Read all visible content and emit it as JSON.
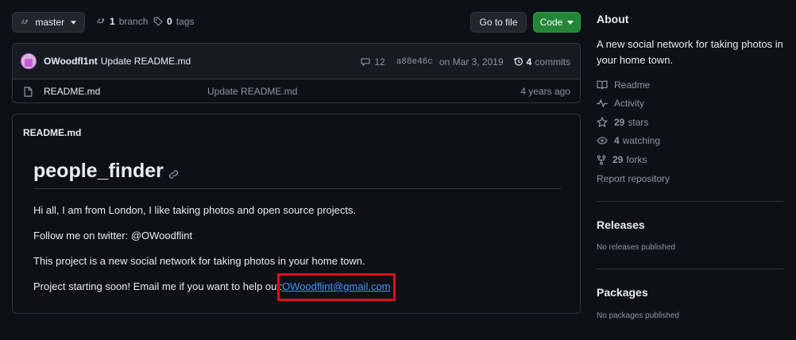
{
  "repo_nav": {
    "branch_name": "master",
    "branch_count": "1",
    "branch_label": "branch",
    "tag_count": "0",
    "tag_label": "tags",
    "go_to_file": "Go to file",
    "code_button": "Code"
  },
  "latest_commit": {
    "author": "OWoodfl1nt",
    "message": "Update README.md",
    "comment_count": "12",
    "sha": "a88e46c",
    "date": "on Mar 3, 2019",
    "commit_count": "4",
    "commit_label": "commits"
  },
  "files": [
    {
      "name": "README.md",
      "message": "Update README.md",
      "age": "4 years ago"
    }
  ],
  "readme": {
    "filename": "README.md",
    "heading": "people_finder",
    "lines": [
      "Hi all, I am from London, I like taking photos and open source projects.",
      "Follow me on twitter: @OWoodflint",
      "This project is a new social network for taking photos in your home town."
    ],
    "help_line": "Project starting soon! Email me if you want to help out:",
    "email": "OWoodflint@gmail.com"
  },
  "sidebar": {
    "about_title": "About",
    "about_description": "A new social network for taking photos in your home town.",
    "readme_label": "Readme",
    "activity_label": "Activity",
    "stars_count": "29",
    "stars_label": "stars",
    "watching_count": "4",
    "watching_label": "watching",
    "forks_count": "29",
    "forks_label": "forks",
    "report_label": "Report repository",
    "releases_title": "Releases",
    "releases_empty": "No releases published",
    "packages_title": "Packages",
    "packages_empty": "No packages published"
  },
  "colors": {
    "background": "#0d1117",
    "border": "#30363d",
    "code_green": "#238636",
    "link_blue": "#4493f8",
    "highlight_red": "#e00d1c"
  }
}
